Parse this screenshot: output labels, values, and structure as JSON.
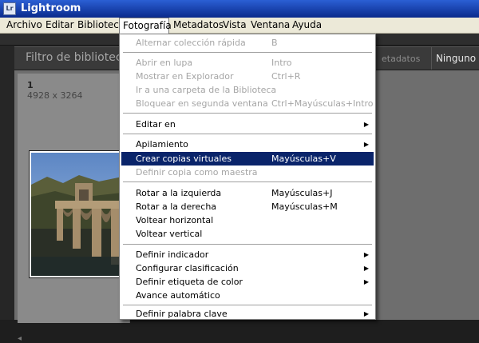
{
  "app": {
    "title": "Lightroom",
    "icon": "Lr"
  },
  "menubar": [
    "Archivo",
    "Editar",
    "Biblioteca",
    "Fotografía",
    "Metadatos",
    "Vista",
    "Ventana",
    "Ayuda"
  ],
  "filter": {
    "title": "Filtro de biblioteca",
    "meta_label": "etadatos",
    "none_label": "Ninguno"
  },
  "grid": {
    "index": "1",
    "dims": "4928 x 3264"
  },
  "fotografia_menu": {
    "alternar": "Alternar colección rápida",
    "alternar_sc": "B",
    "abrir": "Abrir en lupa",
    "abrir_sc": "Intro",
    "mostrar": "Mostrar en Explorador",
    "mostrar_sc": "Ctrl+R",
    "ir": "Ir a una carpeta de la Biblioteca",
    "bloquear": "Bloquear en segunda ventana",
    "bloquear_sc": "Ctrl+Mayúsculas+Intro",
    "editar_en": "Editar en",
    "apilamiento": "Apilamiento",
    "crear_copias": "Crear copias virtuales",
    "crear_copias_sc": "Mayúsculas+V",
    "definir_copia": "Definir copia como maestra",
    "rotar_izq": "Rotar a la izquierda",
    "rotar_izq_sc": "Mayúsculas+J",
    "rotar_der": "Rotar a la derecha",
    "rotar_der_sc": "Mayúsculas+M",
    "voltear_h": "Voltear horizontal",
    "voltear_v": "Voltear vertical",
    "definir_indicador": "Definir indicador",
    "configurar_clasif": "Configurar clasificación",
    "definir_etiqueta": "Definir etiqueta de color",
    "avance": "Avance automático",
    "definir_palabra": "Definir palabra clave"
  }
}
